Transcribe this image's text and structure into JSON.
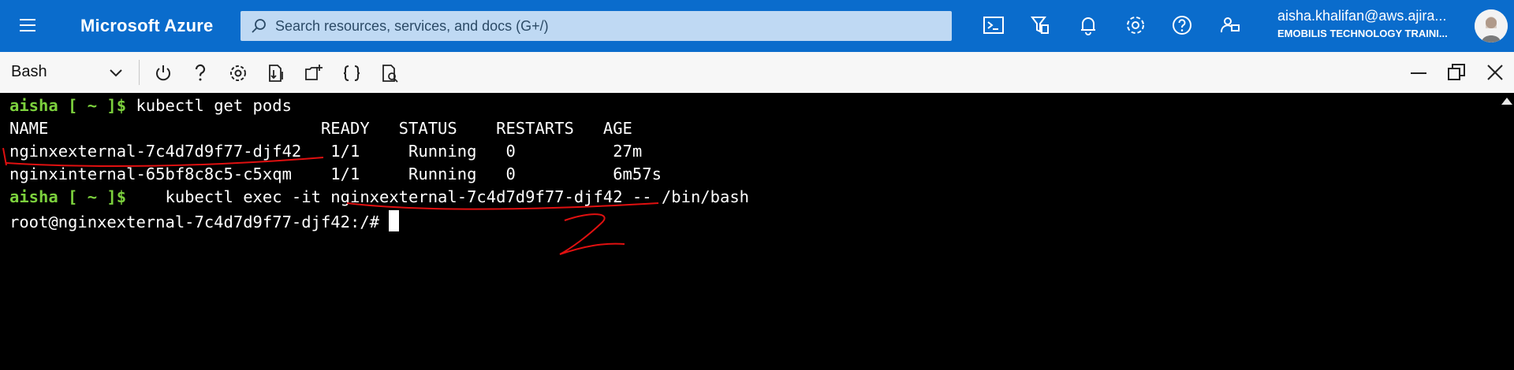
{
  "header": {
    "brand": "Microsoft Azure",
    "search_placeholder": "Search resources, services, and docs (G+/)",
    "user_name": "aisha.khalifan@aws.ajira...",
    "user_org": "EMOBILIS TECHNOLOGY TRAINI...",
    "grip": "....",
    "icons": [
      "cloud-shell-icon",
      "directory-filter-icon",
      "notifications-icon",
      "settings-icon",
      "help-icon",
      "feedback-icon"
    ]
  },
  "toolbar": {
    "shell": "Bash",
    "icons": [
      "power-icon",
      "help-icon",
      "settings-icon",
      "upload-download-icon",
      "new-session-icon",
      "editor-icon",
      "web-preview-icon"
    ],
    "window": [
      "minimize-icon",
      "restore-icon",
      "close-icon"
    ]
  },
  "terminal": {
    "l1_user": "aisha [ ~ ]$",
    "l1_cmd": " kubectl get pods",
    "l2": "NAME                            READY   STATUS    RESTARTS   AGE",
    "l3": "nginxexternal-7c4d7d9f77-djf42   1/1     Running   0          27m",
    "l4": "nginxinternal-65bf8c8c5-c5xqm    1/1     Running   0          6m57s",
    "l5_user": "aisha [ ~ ]$",
    "l5_cmd": "    kubectl exec -it nginxexternal-7c4d7d9f77-djf42 -- /bin/bash",
    "l6": "root@nginxexternal-7c4d7d9f77-djf42:/# "
  },
  "colors": {
    "topbar": "#0a6ccc",
    "prompt_green": "#7cd13d",
    "annotation_red": "#e01010"
  }
}
